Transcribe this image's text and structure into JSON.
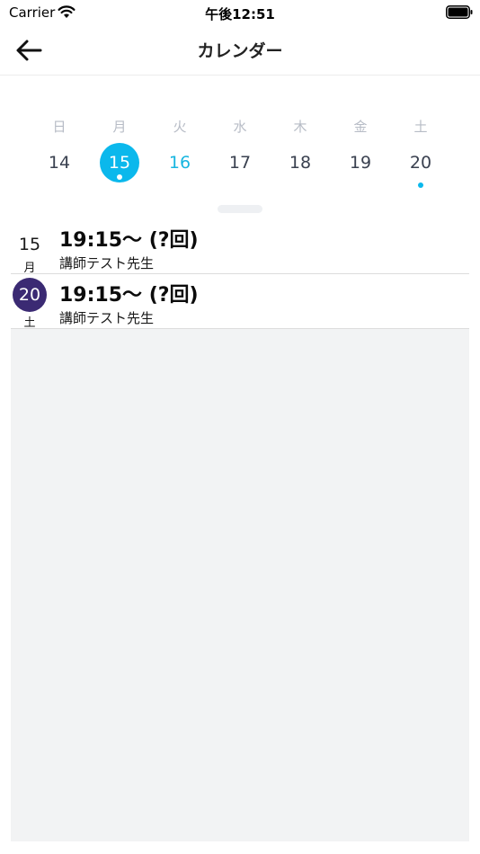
{
  "status_bar": {
    "carrier": "Carrier",
    "time": "午後12:51"
  },
  "nav": {
    "title": "カレンダー"
  },
  "week": {
    "weekday_labels": [
      "日",
      "月",
      "火",
      "水",
      "木",
      "金",
      "土"
    ],
    "days": [
      "14",
      "15",
      "16",
      "17",
      "18",
      "19",
      "20"
    ],
    "selected_index": 1,
    "today_index": 2,
    "event_indices": [
      1,
      6
    ]
  },
  "agenda": [
    {
      "day": "15",
      "weekday": "月",
      "time": "19:15〜 (?回)",
      "teacher": "講師テスト先生",
      "highlighted": false
    },
    {
      "day": "20",
      "weekday": "土",
      "time": "19:15〜 (?回)",
      "teacher": "講師テスト先生",
      "highlighted": true
    }
  ],
  "colors": {
    "accent": "#0bb8ec",
    "today_text": "#18b6e0",
    "highlight_date": "#3b2a73",
    "agenda_background": "#f2f3f4"
  }
}
